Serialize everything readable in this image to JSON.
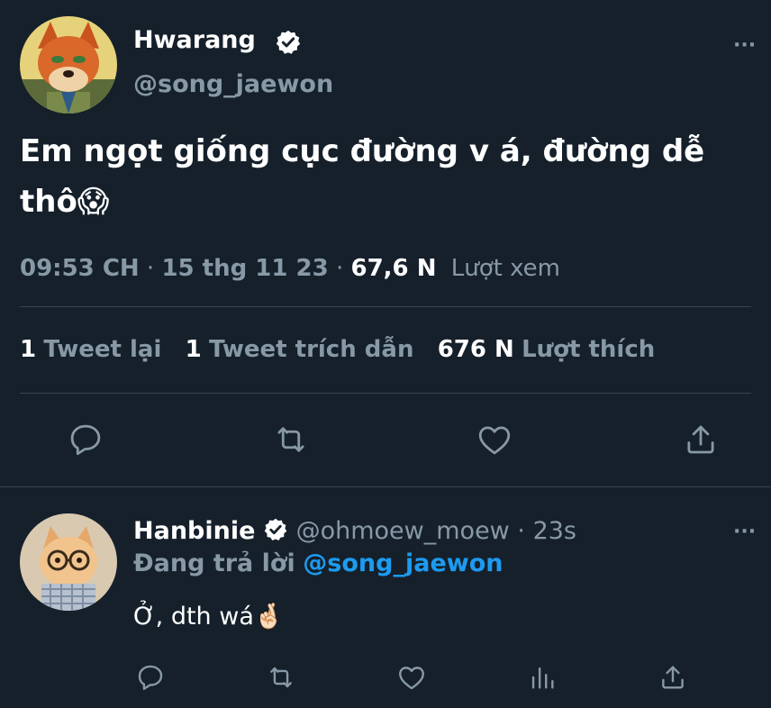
{
  "tweet": {
    "author_name": "Hwarang",
    "author_handle": "@song_jaewon",
    "text_line1": "Em ngọt giống cục đường v á, đường dễ",
    "text_line2": "thô",
    "emoji": "😱",
    "time": "09:53 CH",
    "date": "15 thg 11 23",
    "sep1": "·",
    "sep2": "·",
    "views_count": "67,6 N",
    "views_label": "Lượt xem",
    "retweets_count": "1",
    "retweets_label": "Tweet lại",
    "quotes_count": "1",
    "quotes_label": "Tweet trích dẫn",
    "likes_count": "676 N",
    "likes_label": "Lượt thích",
    "more": "···"
  },
  "reply": {
    "author_name": "Hanbinie",
    "author_handle": "@ohmoew_moew",
    "sep": "·",
    "time": "23s",
    "replying_label": "Đang trả lời",
    "replying_to": "@song_jaewon",
    "text": "Ở, dth wá",
    "emoji": "🤞🏻",
    "more": "···"
  },
  "colors": {
    "background": "#15202b",
    "text": "#ffffff",
    "muted": "#8899a6",
    "link": "#1d9bf0",
    "verified": "#ffffff"
  }
}
